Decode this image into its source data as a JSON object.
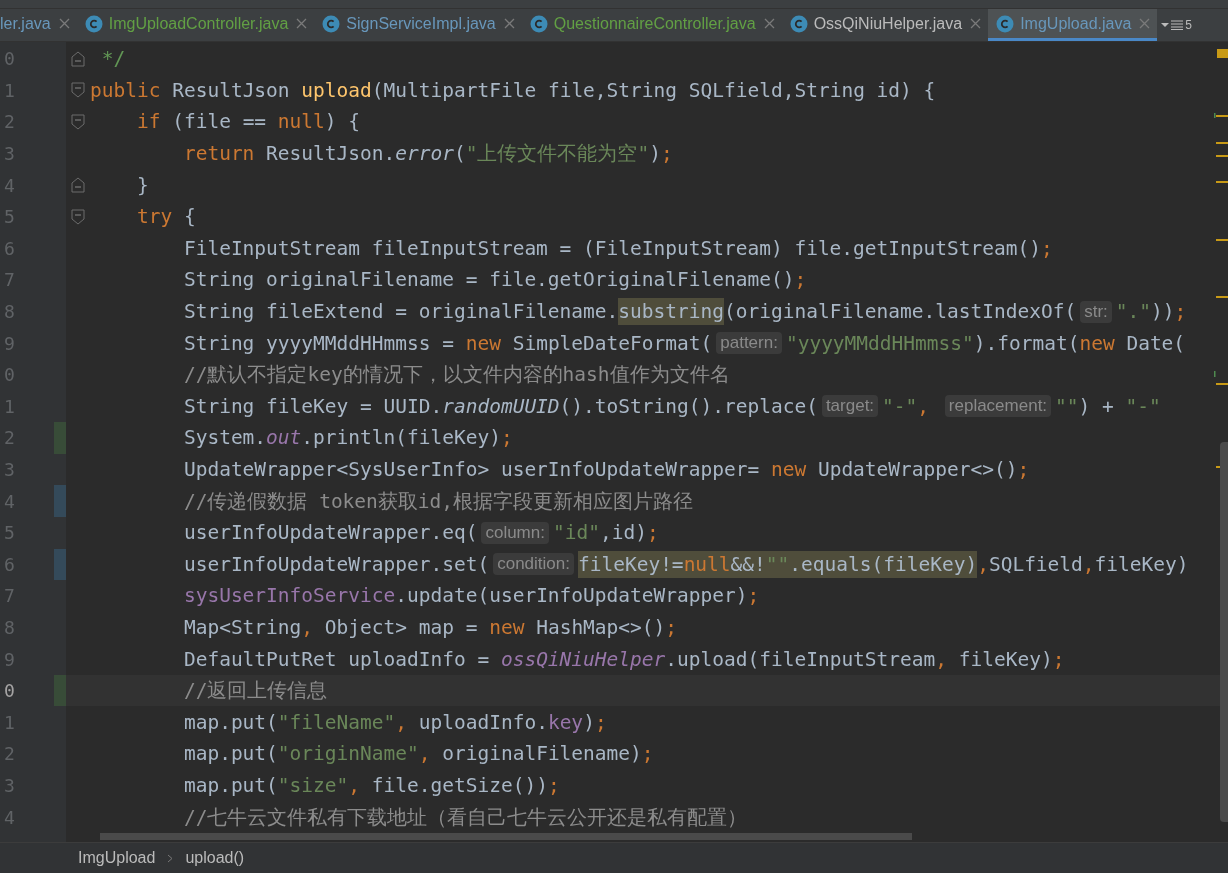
{
  "tabs": [
    {
      "label": "ler.java",
      "color": "#6897bb",
      "icon": false,
      "selected": false
    },
    {
      "label": "ImgUploadController.java",
      "color": "#62a044",
      "icon": true,
      "selected": false
    },
    {
      "label": "SignServiceImpl.java",
      "color": "#6897bb",
      "icon": true,
      "selected": false
    },
    {
      "label": "QuestionnaireController.java",
      "color": "#62a044",
      "icon": true,
      "selected": false
    },
    {
      "label": "OssQiNiuHelper.java",
      "color": "#bbbbbb",
      "icon": true,
      "selected": false
    },
    {
      "label": "ImgUpload.java",
      "color": "#6897bb",
      "icon": true,
      "selected": true
    }
  ],
  "tab_overflow": {
    "count": "5"
  },
  "editor": {
    "lines": [
      {
        "number": "0",
        "fold": {
          "kind": "end"
        },
        "current": false,
        "tokens": [
          {
            "t": " */",
            "kind": "doc"
          }
        ]
      },
      {
        "number": "1",
        "fold": {
          "kind": "start"
        },
        "current": false,
        "tokens": [
          {
            "t": "public",
            "kind": "kw"
          },
          {
            "t": " ResultJson ",
            "kind": "plain"
          },
          {
            "t": "upload",
            "kind": "method"
          },
          {
            "t": "(MultipartFile file,String SQLfield,String id) {",
            "kind": "plain"
          }
        ]
      },
      {
        "number": "2",
        "fold": {
          "kind": "start"
        },
        "current": false,
        "tokens": [
          {
            "t": "    if",
            "kind": "kw"
          },
          {
            "t": " (file == ",
            "kind": "plain"
          },
          {
            "t": "null",
            "kind": "kw"
          },
          {
            "t": ") {",
            "kind": "plain"
          }
        ]
      },
      {
        "number": "3",
        "current": false,
        "tokens": [
          {
            "t": "        return",
            "kind": "kw"
          },
          {
            "t": " ResultJson.",
            "kind": "plain"
          },
          {
            "t": "error",
            "kind": "static"
          },
          {
            "t": "(",
            "kind": "plain"
          },
          {
            "t": "\"上传文件不能为空\"",
            "kind": "str"
          },
          {
            "t": ")",
            "kind": "plain"
          },
          {
            "t": ";",
            "kind": "kw"
          }
        ]
      },
      {
        "number": "4",
        "fold": {
          "kind": "end"
        },
        "current": false,
        "tokens": [
          {
            "t": "    }",
            "kind": "plain"
          }
        ]
      },
      {
        "number": "5",
        "fold": {
          "kind": "start"
        },
        "current": false,
        "tokens": [
          {
            "t": "    try",
            "kind": "kw"
          },
          {
            "t": " {",
            "kind": "plain"
          }
        ]
      },
      {
        "number": "6",
        "current": false,
        "tokens": [
          {
            "t": "        FileInputStream fileInputStream = (FileInputStream) file.getInputStream()",
            "kind": "plain"
          },
          {
            "t": ";",
            "kind": "kw"
          }
        ]
      },
      {
        "number": "7",
        "current": false,
        "tokens": [
          {
            "t": "        String originalFilename = file.getOriginalFilename()",
            "kind": "plain"
          },
          {
            "t": ";",
            "kind": "kw"
          }
        ]
      },
      {
        "number": "8",
        "current": false,
        "tokens": [
          {
            "t": "        String fileExtend = originalFilename.",
            "kind": "plain"
          },
          {
            "t": "substring",
            "kind": "plain-hl"
          },
          {
            "t": "(originalFilename.lastIndexOf(",
            "kind": "plain"
          },
          {
            "t": "str:",
            "kind": "hint"
          },
          {
            "t": "\".\"",
            "kind": "str"
          },
          {
            "t": "))",
            "kind": "plain"
          },
          {
            "t": ";",
            "kind": "kw"
          }
        ]
      },
      {
        "number": "9",
        "current": false,
        "tokens": [
          {
            "t": "        String yyyyMMddHHmmss = ",
            "kind": "plain"
          },
          {
            "t": "new",
            "kind": "kw"
          },
          {
            "t": " SimpleDateFormat(",
            "kind": "plain"
          },
          {
            "t": "pattern:",
            "kind": "hint"
          },
          {
            "t": "\"yyyyMMddHHmmss\"",
            "kind": "str"
          },
          {
            "t": ").format(",
            "kind": "plain"
          },
          {
            "t": "new",
            "kind": "kw"
          },
          {
            "t": " Date(",
            "kind": "plain"
          }
        ]
      },
      {
        "number": "0",
        "current": false,
        "tokens": [
          {
            "t": "        //默认不指定key的情况下，以文件内容的hash值作为文件名",
            "kind": "cmt"
          }
        ]
      },
      {
        "number": "1",
        "current": false,
        "tokens": [
          {
            "t": "        String fileKey = UUID.",
            "kind": "plain"
          },
          {
            "t": "randomUUID",
            "kind": "static"
          },
          {
            "t": "().toString().replace(",
            "kind": "plain"
          },
          {
            "t": "target:",
            "kind": "hint"
          },
          {
            "t": "\"-\"",
            "kind": "str"
          },
          {
            "t": ", ",
            "kind": "kw"
          },
          {
            "t": "replacement:",
            "kind": "hint"
          },
          {
            "t": "\"\"",
            "kind": "str"
          },
          {
            "t": ") + ",
            "kind": "plain"
          },
          {
            "t": "\"-\"",
            "kind": "str"
          }
        ]
      },
      {
        "number": "2",
        "gutter_mark": {
          "color": "#384c38"
        },
        "current": false,
        "tokens": [
          {
            "t": "        System.",
            "kind": "plain"
          },
          {
            "t": "out",
            "kind": "field-i"
          },
          {
            "t": ".println(fileKey)",
            "kind": "plain"
          },
          {
            "t": ";",
            "kind": "kw"
          }
        ]
      },
      {
        "number": "3",
        "current": false,
        "tokens": [
          {
            "t": "        UpdateWrapper<SysUserInfo> userInfoUpdateWrapper= ",
            "kind": "plain"
          },
          {
            "t": "new",
            "kind": "kw"
          },
          {
            "t": " UpdateWrapper<>()",
            "kind": "plain"
          },
          {
            "t": ";",
            "kind": "kw"
          }
        ]
      },
      {
        "number": "4",
        "gutter_mark": {
          "color": "#344a5a"
        },
        "current": false,
        "tokens": [
          {
            "t": "        //传递假数据 token获取id,根据字段更新相应图片路径",
            "kind": "cmt"
          }
        ]
      },
      {
        "number": "5",
        "current": false,
        "tokens": [
          {
            "t": "        userInfoUpdateWrapper.eq(",
            "kind": "plain"
          },
          {
            "t": "column:",
            "kind": "hint"
          },
          {
            "t": "\"id\"",
            "kind": "str"
          },
          {
            "t": ",id)",
            "kind": "plain"
          },
          {
            "t": ";",
            "kind": "kw"
          }
        ]
      },
      {
        "number": "6",
        "gutter_mark": {
          "color": "#344a5a"
        },
        "current": false,
        "tokens": [
          {
            "t": "        userInfoUpdateWrapper.set(",
            "kind": "plain"
          },
          {
            "t": "condition:",
            "kind": "hint"
          },
          {
            "t": "fileKey!=",
            "kind": "plain-hl"
          },
          {
            "t": "null",
            "kind": "kw-hl"
          },
          {
            "t": "&&!",
            "kind": "plain-hl"
          },
          {
            "t": "\"\"",
            "kind": "str-hl"
          },
          {
            "t": ".equals(fileKey)",
            "kind": "plain-hl"
          },
          {
            "t": ",",
            "kind": "kw"
          },
          {
            "t": "SQLfield",
            "kind": "plain"
          },
          {
            "t": ",",
            "kind": "kw"
          },
          {
            "t": "fileKey)",
            "kind": "plain"
          }
        ]
      },
      {
        "number": "7",
        "current": false,
        "tokens": [
          {
            "t": "        sysUserInfoService",
            "kind": "field"
          },
          {
            "t": ".update(userInfoUpdateWrapper)",
            "kind": "plain"
          },
          {
            "t": ";",
            "kind": "kw"
          }
        ]
      },
      {
        "number": "8",
        "current": false,
        "tokens": [
          {
            "t": "        Map<String",
            "kind": "plain"
          },
          {
            "t": ",",
            "kind": "kw"
          },
          {
            "t": " Object> map = ",
            "kind": "plain"
          },
          {
            "t": "new",
            "kind": "kw"
          },
          {
            "t": " HashMap<>()",
            "kind": "plain"
          },
          {
            "t": ";",
            "kind": "kw"
          }
        ]
      },
      {
        "number": "9",
        "current": false,
        "tokens": [
          {
            "t": "        DefaultPutRet uploadInfo = ",
            "kind": "plain"
          },
          {
            "t": "ossQiNiuHelper",
            "kind": "field-i"
          },
          {
            "t": ".upload(fileInputStream",
            "kind": "plain"
          },
          {
            "t": ",",
            "kind": "kw"
          },
          {
            "t": " fileKey)",
            "kind": "plain"
          },
          {
            "t": ";",
            "kind": "kw"
          }
        ]
      },
      {
        "number": "0",
        "gutter_mark": {
          "color": "#384c38"
        },
        "current": true,
        "tokens": [
          {
            "t": "        //返回上传信息",
            "kind": "cmt"
          }
        ]
      },
      {
        "number": "1",
        "current": false,
        "tokens": [
          {
            "t": "        map.put(",
            "kind": "plain"
          },
          {
            "t": "\"fileName\"",
            "kind": "str"
          },
          {
            "t": ",",
            "kind": "kw"
          },
          {
            "t": " uploadInfo.",
            "kind": "plain"
          },
          {
            "t": "key",
            "kind": "field"
          },
          {
            "t": ")",
            "kind": "plain"
          },
          {
            "t": ";",
            "kind": "kw"
          }
        ]
      },
      {
        "number": "2",
        "current": false,
        "tokens": [
          {
            "t": "        map.put(",
            "kind": "plain"
          },
          {
            "t": "\"originName\"",
            "kind": "str"
          },
          {
            "t": ",",
            "kind": "kw"
          },
          {
            "t": " originalFilename)",
            "kind": "plain"
          },
          {
            "t": ";",
            "kind": "kw"
          }
        ]
      },
      {
        "number": "3",
        "current": false,
        "tokens": [
          {
            "t": "        map.put(",
            "kind": "plain"
          },
          {
            "t": "\"size\"",
            "kind": "str"
          },
          {
            "t": ",",
            "kind": "kw"
          },
          {
            "t": " file.getSize())",
            "kind": "plain"
          },
          {
            "t": ";",
            "kind": "kw"
          }
        ]
      },
      {
        "number": "4",
        "current": false,
        "tokens": [
          {
            "t": "        //七牛云文件私有下载地址（看自己七牛云公开还是私有配置）",
            "kind": "cmt"
          }
        ]
      }
    ]
  },
  "breadcrumb": [
    "ImgUpload",
    "upload()"
  ]
}
